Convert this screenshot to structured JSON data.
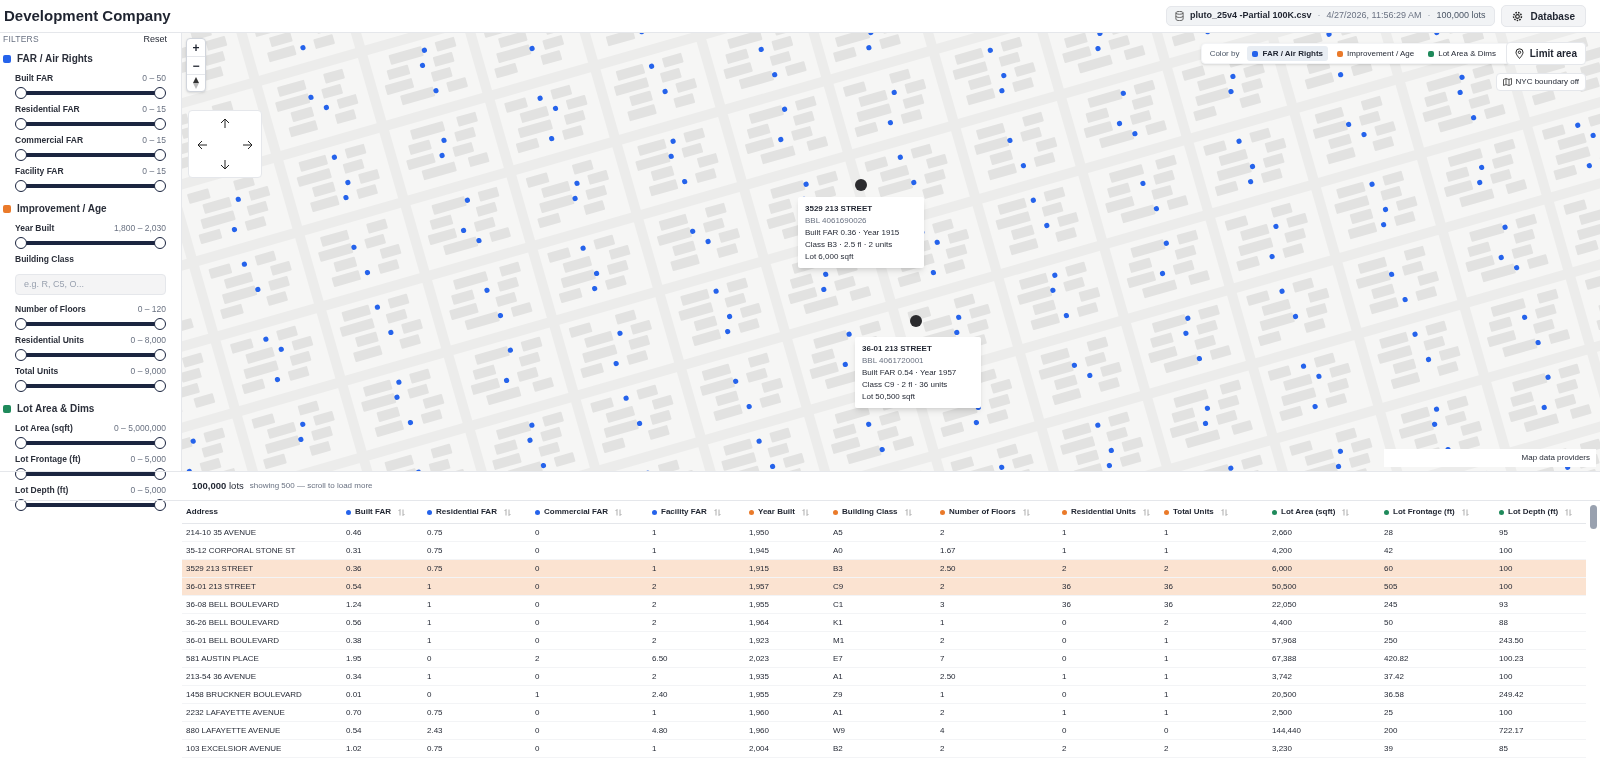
{
  "app": {
    "title": "Development Company"
  },
  "header": {
    "file_chip": {
      "name": "pluto_25v4 -Partial 100K.csv",
      "timestamp": "4/27/2026, 11:56:29 AM",
      "count": "100,000 lots",
      "separators": [
        "·",
        "·"
      ]
    },
    "database_button": "Database"
  },
  "sidebar": {
    "title": "FILTERS",
    "reset": "Reset",
    "groups": [
      {
        "label": "FAR / Air Rights",
        "color": "#2563eb",
        "filters": [
          {
            "kind": "range",
            "label": "Built FAR",
            "range": "0 – 50",
            "level": 1
          },
          {
            "kind": "range",
            "label": "Residential FAR",
            "range": "0 – 15",
            "level": 1
          },
          {
            "kind": "range",
            "label": "Commercial FAR",
            "range": "0 – 15",
            "level": 1
          },
          {
            "kind": "range",
            "label": "Facility FAR",
            "range": "0 – 15",
            "level": 1
          }
        ]
      },
      {
        "label": "Improvement / Age",
        "color": "#ea7a2a",
        "filters": [
          {
            "kind": "range",
            "label": "Year Built",
            "range": "1,800 – 2,030",
            "level": 1
          },
          {
            "kind": "text",
            "label": "Building Class",
            "placeholder": "e.g. R, C5, O..."
          },
          {
            "kind": "range",
            "label": "Number of Floors",
            "range": "0 – 120",
            "level": 1
          },
          {
            "kind": "range",
            "label": "Residential Units",
            "range": "0 – 8,000",
            "level": 1
          },
          {
            "kind": "range",
            "label": "Total Units",
            "range": "0 – 9,000",
            "level": 1
          }
        ]
      },
      {
        "label": "Lot Area & Dims",
        "color": "#1f8a5b",
        "filters": [
          {
            "kind": "range",
            "label": "Lot Area (sqft)",
            "range": "0 – 5,000,000",
            "level": 1
          },
          {
            "kind": "range",
            "label": "Lot Frontage (ft)",
            "range": "0 – 5,000",
            "level": 1
          },
          {
            "kind": "range",
            "label": "Lot Depth (ft)",
            "range": "0 – 5,000",
            "level": 1
          }
        ]
      }
    ]
  },
  "map": {
    "zoom_in": "+",
    "zoom_out": "−",
    "color_by": {
      "label": "Color by",
      "options": [
        {
          "label": "FAR / Air Rights",
          "color": "#2563eb",
          "selected": true
        },
        {
          "label": "Improvement / Age",
          "color": "#ea7a2a",
          "selected": false
        },
        {
          "label": "Lot Area & Dims",
          "color": "#1f8a5b",
          "selected": false
        }
      ]
    },
    "limit_area": "Limit area",
    "boundary_toggle": "NYC boundary off",
    "attribution": "Map data providers",
    "tooltips": [
      {
        "title": "3529 213 STREET",
        "bbl": "BBL 4061690026",
        "line_1": "Built FAR 0.36 · Year 1915",
        "line_2": "Class B3 · 2.5 fl · 2 units",
        "line_3": "Lot 6,000 sqft"
      },
      {
        "title": "36-01 213 STREET",
        "bbl": "BBL 4061720001",
        "line_1": "Built FAR 0.54 · Year 1957",
        "line_2": "Class C9 · 2 fl · 36 units",
        "line_3": "Lot 50,500 sqft"
      }
    ]
  },
  "table": {
    "summary": {
      "count": "100,000",
      "unit": "lots",
      "note": "showing 500 — scroll to load more"
    },
    "columns": [
      {
        "label": "Address",
        "sortable": false
      },
      {
        "label": "Built FAR",
        "color": "#2563eb",
        "sortable": true
      },
      {
        "label": "Residential FAR",
        "color": "#2563eb",
        "sortable": true
      },
      {
        "label": "Commercial FAR",
        "color": "#2563eb",
        "sortable": true
      },
      {
        "label": "Facility FAR",
        "color": "#2563eb",
        "sortable": true
      },
      {
        "label": "Year Built",
        "color": "#ea7a2a",
        "sortable": true
      },
      {
        "label": "Building Class",
        "color": "#ea7a2a",
        "sortable": true
      },
      {
        "label": "Number of Floors",
        "color": "#ea7a2a",
        "sortable": true
      },
      {
        "label": "Residential Units",
        "color": "#ea7a2a",
        "sortable": true
      },
      {
        "label": "Total Units",
        "color": "#ea7a2a",
        "sortable": true
      },
      {
        "label": "Lot Area (sqft)",
        "color": "#1f8a5b",
        "sortable": true
      },
      {
        "label": "Lot Frontage (ft)",
        "color": "#1f8a5b",
        "sortable": true
      },
      {
        "label": "Lot Depth (ft)",
        "color": "#1f8a5b",
        "sortable": true
      }
    ],
    "rows": [
      {
        "selected": false,
        "cells": [
          "214-10 35 AVENUE",
          "0.46",
          "0.75",
          "0",
          "1",
          "1,950",
          "A5",
          "2",
          "1",
          "1",
          "2,660",
          "28",
          "95"
        ]
      },
      {
        "selected": false,
        "cells": [
          "35-12 CORPORAL STONE ST",
          "0.31",
          "0.75",
          "0",
          "1",
          "1,945",
          "A0",
          "1.67",
          "1",
          "1",
          "4,200",
          "42",
          "100"
        ]
      },
      {
        "selected": true,
        "cells": [
          "3529 213 STREET",
          "0.36",
          "0.75",
          "0",
          "1",
          "1,915",
          "B3",
          "2.50",
          "2",
          "2",
          "6,000",
          "60",
          "100"
        ]
      },
      {
        "selected": true,
        "cells": [
          "36-01 213 STREET",
          "0.54",
          "1",
          "0",
          "2",
          "1,957",
          "C9",
          "2",
          "36",
          "36",
          "50,500",
          "505",
          "100"
        ]
      },
      {
        "selected": false,
        "cells": [
          "36-08 BELL BOULEVARD",
          "1.24",
          "1",
          "0",
          "2",
          "1,955",
          "C1",
          "3",
          "36",
          "36",
          "22,050",
          "245",
          "93"
        ]
      },
      {
        "selected": false,
        "cells": [
          "36-26 BELL BOULEVARD",
          "0.56",
          "1",
          "0",
          "2",
          "1,964",
          "K1",
          "1",
          "0",
          "2",
          "4,400",
          "50",
          "88"
        ]
      },
      {
        "selected": false,
        "cells": [
          "36-01 BELL BOULEVARD",
          "0.38",
          "1",
          "0",
          "2",
          "1,923",
          "M1",
          "2",
          "0",
          "1",
          "57,968",
          "250",
          "243.50"
        ]
      },
      {
        "selected": false,
        "cells": [
          "581 AUSTIN PLACE",
          "1.95",
          "0",
          "2",
          "6.50",
          "2,023",
          "E7",
          "7",
          "0",
          "1",
          "67,388",
          "420.82",
          "100.23"
        ]
      },
      {
        "selected": false,
        "cells": [
          "213-54 36 AVENUE",
          "0.34",
          "1",
          "0",
          "2",
          "1,935",
          "A1",
          "2.50",
          "1",
          "1",
          "3,742",
          "37.42",
          "100"
        ]
      },
      {
        "selected": false,
        "cells": [
          "1458 BRUCKNER BOULEVARD",
          "0.01",
          "0",
          "1",
          "2.40",
          "1,955",
          "Z9",
          "1",
          "0",
          "1",
          "20,500",
          "36.58",
          "249.42"
        ]
      },
      {
        "selected": false,
        "cells": [
          "2232 LAFAYETTE AVENUE",
          "0.70",
          "0.75",
          "0",
          "1",
          "1,960",
          "A1",
          "2",
          "1",
          "1",
          "2,500",
          "25",
          "100"
        ]
      },
      {
        "selected": false,
        "cells": [
          "880 LAFAYETTE AVENUE",
          "0.54",
          "2.43",
          "0",
          "4.80",
          "1,960",
          "W9",
          "4",
          "0",
          "0",
          "144,440",
          "200",
          "722.17"
        ]
      },
      {
        "selected": false,
        "cells": [
          "103 EXCELSIOR AVENUE",
          "1.02",
          "0.75",
          "0",
          "1",
          "2,004",
          "B2",
          "2",
          "2",
          "2",
          "3,230",
          "39",
          "85"
        ]
      }
    ]
  }
}
